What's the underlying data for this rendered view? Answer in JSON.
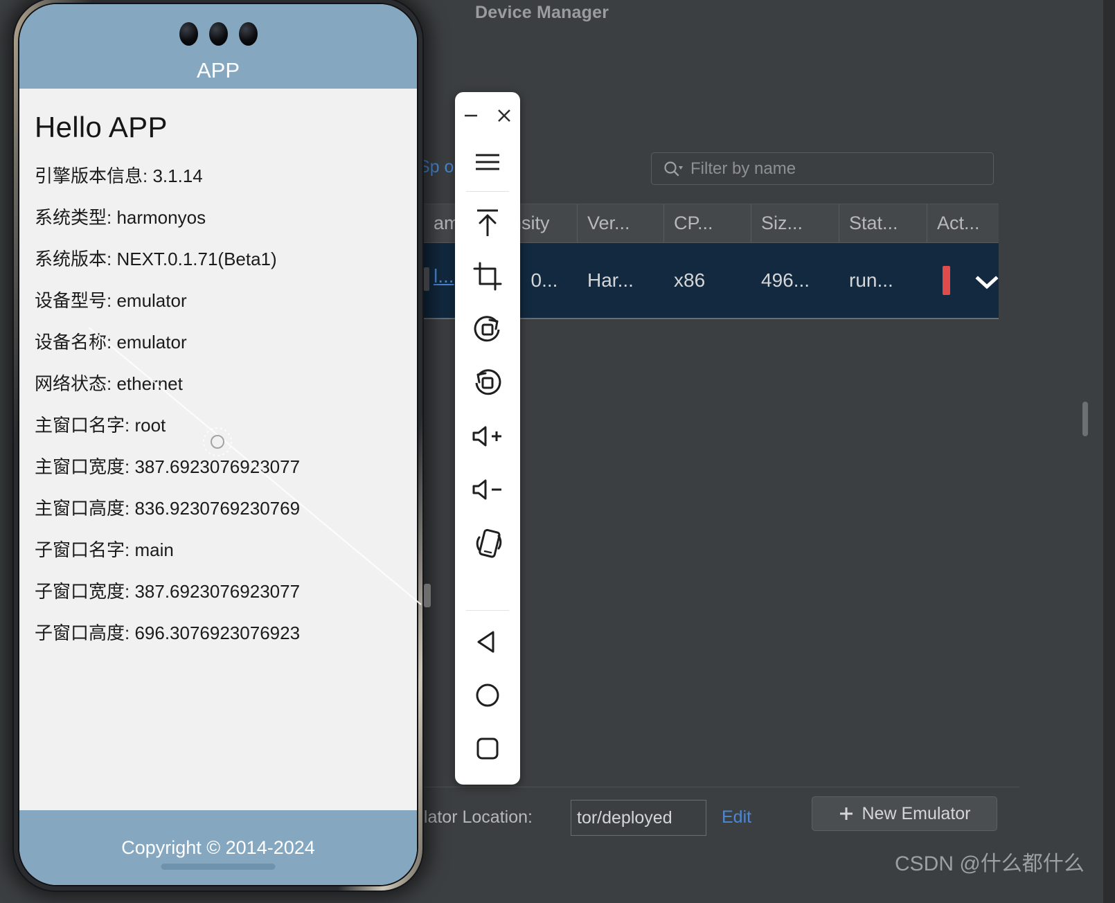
{
  "ide": {
    "window_title": "Device Manager",
    "spec_link": "Sp                    ons",
    "search": {
      "placeholder": "Filter by name",
      "icon": "search-icon"
    },
    "table": {
      "headers": [
        "ame",
        "nsity",
        "Ver...",
        "CP...",
        "Siz...",
        "Stat...",
        "Act..."
      ],
      "rows": [
        {
          "name": "l...",
          "density": "0...",
          "version": "Har...",
          "cpu": "x86",
          "size": "496...",
          "status": "run...",
          "action_icons": [
            "stop-square-icon",
            "chevron-down-icon"
          ]
        }
      ]
    },
    "bottom": {
      "location_label": "ulator Location:",
      "location_value": "tor/deployed",
      "edit_label": "Edit",
      "new_emulator_label": "New Emulator",
      "plus_icon": "plus-icon"
    },
    "watermark": "CSDN @什么都什么",
    "colors": {
      "background": "#3c3f41",
      "header_bg": "#45484a",
      "selected_row": "#12293f",
      "link": "#4a88d6",
      "stop_red": "#e04b4c",
      "text": "#b6b8ba"
    }
  },
  "emulator_toolbar": {
    "window_buttons": [
      {
        "name": "minimize-button",
        "glyph": "minus"
      },
      {
        "name": "close-button",
        "glyph": "times"
      }
    ],
    "items": [
      {
        "name": "menu-icon",
        "label": "Menu"
      },
      {
        "name": "power-icon",
        "label": "Power"
      },
      {
        "name": "screenshot-crop-icon",
        "label": "Screenshot"
      },
      {
        "name": "rotate-left-icon",
        "label": "Rotate Left"
      },
      {
        "name": "rotate-right-icon",
        "label": "Rotate Right"
      },
      {
        "name": "volume-up-icon",
        "label": "Volume Up"
      },
      {
        "name": "volume-down-icon",
        "label": "Volume Down"
      },
      {
        "name": "shake-device-icon",
        "label": "Shake"
      },
      {
        "name": "back-triangle-icon",
        "label": "Back"
      },
      {
        "name": "home-circle-icon",
        "label": "Home"
      },
      {
        "name": "recents-square-icon",
        "label": "Recents"
      }
    ]
  },
  "phone": {
    "header_title": "APP",
    "heading": "Hello APP",
    "info_lines": [
      "引擎版本信息: 3.1.14",
      "系统类型: harmonyos",
      "系统版本: NEXT.0.1.71(Beta1)",
      "设备型号: emulator",
      "设备名称: emulator",
      "网络状态: ethernet",
      "主窗口名字: root",
      "主窗口宽度: 387.6923076923077",
      "主窗口高度: 836.9230769230769",
      "子窗口名字: main",
      "子窗口宽度: 387.6923076923077",
      "子窗口高度: 696.3076923076923"
    ],
    "copyright": "Copyright © 2014-2024",
    "colors": {
      "accent": "#85a8c0",
      "screen_bg": "#f1f1f1"
    }
  }
}
